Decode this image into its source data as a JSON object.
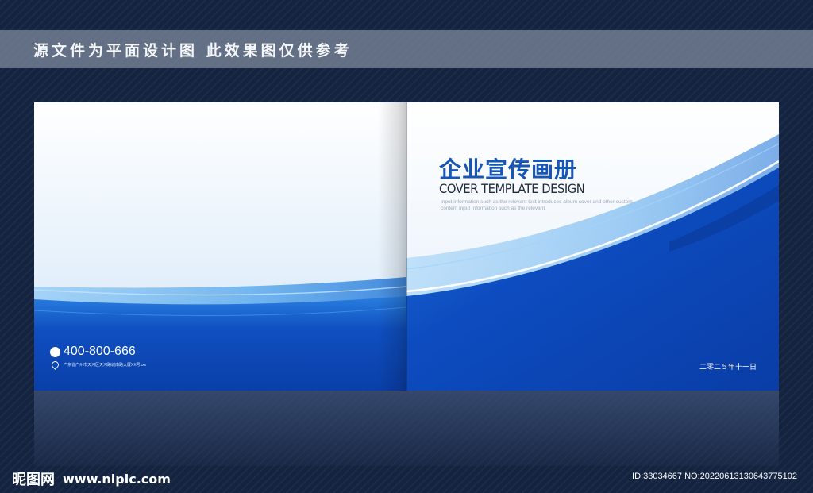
{
  "banner": {
    "text": "源文件为平面设计图 此效果图仅供参考"
  },
  "cover": {
    "title_cn": "企业宣传画册",
    "title_en": "COVER TEMPLATE DESIGN",
    "description": "Input information such as the relevant text introduces album cover and other custom content input information such as the relevant",
    "phone": "400-800-666",
    "address": "广东省广州市天河区天河路城南路大厦XX号xxx",
    "date": "二零二５年十一日"
  },
  "watermark": {
    "brand": "昵图网",
    "url": "www.nipic.com",
    "id_text": "ID:33034667 NO:20220613130643775102"
  },
  "colors": {
    "background": "#142440",
    "brand_blue": "#1656b6",
    "deep_blue": "#0a3fa8"
  }
}
